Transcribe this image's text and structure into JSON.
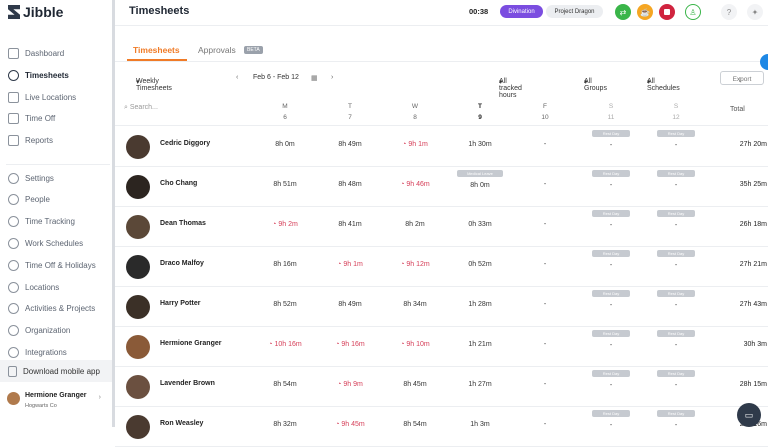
{
  "app": {
    "logo_text": "Jibble"
  },
  "sidebar": {
    "items": [
      {
        "label": "Dashboard",
        "icon": "grid-icon",
        "active": false
      },
      {
        "label": "Timesheets",
        "icon": "clock-icon",
        "active": true
      },
      {
        "label": "Live Locations",
        "icon": "location-pin-icon",
        "active": false
      },
      {
        "label": "Time Off",
        "icon": "suitcase-icon",
        "active": false
      },
      {
        "label": "Reports",
        "icon": "chart-icon",
        "active": false
      }
    ],
    "settings_items": [
      {
        "label": "Settings",
        "icon": "gear-icon"
      },
      {
        "label": "People",
        "icon": "people-icon"
      },
      {
        "label": "Time Tracking",
        "icon": "stopwatch-icon"
      },
      {
        "label": "Work Schedules",
        "icon": "calendar-icon"
      },
      {
        "label": "Time Off & Holidays",
        "icon": "calendar-off-icon"
      },
      {
        "label": "Locations",
        "icon": "map-pin-icon"
      },
      {
        "label": "Activities & Projects",
        "icon": "tag-icon"
      },
      {
        "label": "Organization",
        "icon": "org-icon"
      },
      {
        "label": "Integrations",
        "icon": "plug-icon"
      }
    ],
    "download_label": "Download mobile app",
    "user": {
      "name": "Hermione Granger",
      "org": "Hogwarts Co"
    }
  },
  "topbar": {
    "title": "Timesheets",
    "timer": "00:38",
    "activity_pill": "Divination",
    "project_pill": "Project Dragon"
  },
  "tabs": {
    "timesheets": "Timesheets",
    "approvals": "Approvals",
    "beta": "BETA"
  },
  "filters": {
    "view": "Weekly Timesheets",
    "date_range": "Feb 6 - Feb 12",
    "tracked": "All tracked hours",
    "groups": "All Groups",
    "schedules": "All Schedules",
    "export": "Export"
  },
  "table": {
    "search_placeholder": "Search...",
    "total_label": "Total",
    "days": [
      {
        "dow": "M",
        "num": "6"
      },
      {
        "dow": "T",
        "num": "7"
      },
      {
        "dow": "W",
        "num": "8"
      },
      {
        "dow": "T",
        "num": "9"
      },
      {
        "dow": "F",
        "num": "10"
      },
      {
        "dow": "S",
        "num": "11"
      },
      {
        "dow": "S",
        "num": "12"
      }
    ],
    "rows": [
      {
        "name": "Cedric Diggory",
        "cells": [
          "8h 0m",
          "8h 49m",
          "9h 1m",
          "1h 30m",
          "-",
          "-",
          "-"
        ],
        "over": [
          false,
          false,
          true,
          false,
          false,
          false,
          false
        ],
        "tags": [
          "",
          "",
          "",
          "",
          "",
          "Rest Day",
          "Rest Day"
        ],
        "total": "27h 20m"
      },
      {
        "name": "Cho Chang",
        "cells": [
          "8h 51m",
          "8h 48m",
          "9h 46m",
          "8h 0m",
          "-",
          "-",
          "-"
        ],
        "over": [
          false,
          false,
          true,
          false,
          false,
          false,
          false
        ],
        "tags": [
          "",
          "",
          "",
          "Medical Leave",
          "",
          "Rest Day",
          "Rest Day"
        ],
        "total": "35h 25m"
      },
      {
        "name": "Dean Thomas",
        "cells": [
          "9h 2m",
          "8h 41m",
          "8h 2m",
          "0h 33m",
          "-",
          "-",
          "-"
        ],
        "over": [
          true,
          false,
          false,
          false,
          false,
          false,
          false
        ],
        "tags": [
          "",
          "",
          "",
          "",
          "",
          "Rest Day",
          "Rest Day"
        ],
        "total": "26h 18m"
      },
      {
        "name": "Draco Malfoy",
        "cells": [
          "8h 16m",
          "9h 1m",
          "9h 12m",
          "0h 52m",
          "-",
          "-",
          "-"
        ],
        "over": [
          false,
          true,
          true,
          false,
          false,
          false,
          false
        ],
        "tags": [
          "",
          "",
          "",
          "",
          "",
          "Rest Day",
          "Rest Day"
        ],
        "total": "27h 21m"
      },
      {
        "name": "Harry Potter",
        "cells": [
          "8h 52m",
          "8h 49m",
          "8h 34m",
          "1h 28m",
          "-",
          "-",
          "-"
        ],
        "over": [
          false,
          false,
          false,
          false,
          false,
          false,
          false
        ],
        "tags": [
          "",
          "",
          "",
          "",
          "",
          "Rest Day",
          "Rest Day"
        ],
        "total": "27h 43m"
      },
      {
        "name": "Hermione Granger",
        "cells": [
          "10h 16m",
          "9h 16m",
          "9h 10m",
          "1h 21m",
          "-",
          "-",
          "-"
        ],
        "over": [
          true,
          true,
          true,
          false,
          false,
          false,
          false
        ],
        "tags": [
          "",
          "",
          "",
          "",
          "",
          "Rest Day",
          "Rest Day"
        ],
        "total": "30h 3m"
      },
      {
        "name": "Lavender Brown",
        "cells": [
          "8h 54m",
          "9h 9m",
          "8h 45m",
          "1h 27m",
          "-",
          "-",
          "-"
        ],
        "over": [
          false,
          true,
          false,
          false,
          false,
          false,
          false
        ],
        "tags": [
          "",
          "",
          "",
          "",
          "",
          "Rest Day",
          "Rest Day"
        ],
        "total": "28h 15m"
      },
      {
        "name": "Ron Weasley",
        "cells": [
          "8h 32m",
          "9h 45m",
          "8h 54m",
          "1h 3m",
          "-",
          "-",
          "-"
        ],
        "over": [
          false,
          true,
          false,
          false,
          false,
          false,
          false
        ],
        "tags": [
          "",
          "",
          "",
          "",
          "",
          "Rest Day",
          "Rest Day"
        ],
        "total": "28h 16m"
      }
    ]
  },
  "colors": {
    "accent": "#f07b27",
    "over": "#d6405a",
    "divination": "#7b4de0"
  }
}
